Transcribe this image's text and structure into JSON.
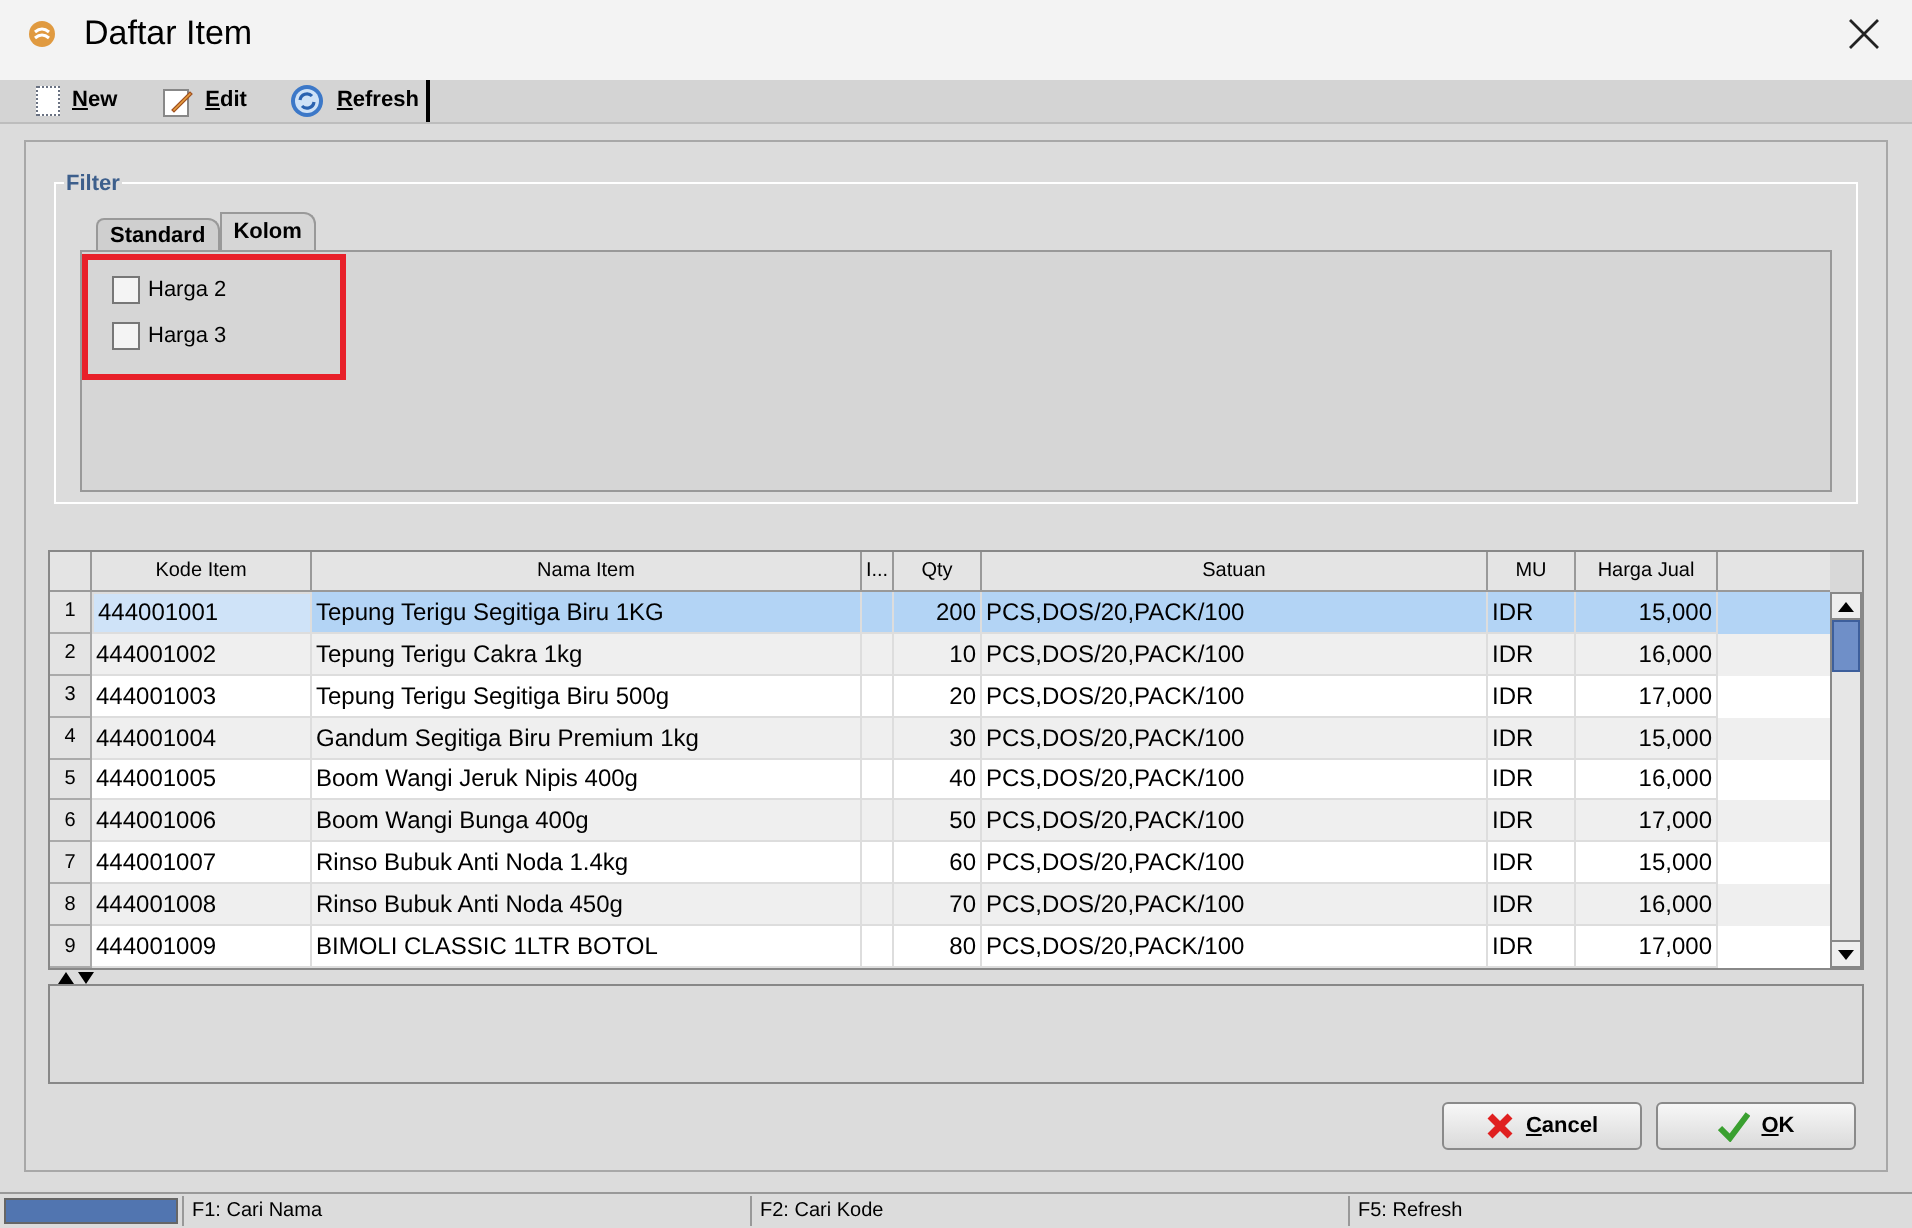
{
  "window": {
    "title": "Daftar Item"
  },
  "toolbar": [
    "New",
    "Edit",
    "Refresh"
  ],
  "filter": {
    "title": "Filter",
    "tabs": [
      {
        "label": "Standard",
        "selected": false
      },
      {
        "label": "Kolom",
        "selected": true
      }
    ],
    "options": [
      {
        "label": "Harga 2",
        "checked": false
      },
      {
        "label": "Harga 3",
        "checked": false
      }
    ]
  },
  "table": {
    "columns": [
      "Kode Item",
      "Nama Item",
      "I...",
      "Qty",
      "Satuan",
      "MU",
      "Harga Jual"
    ],
    "rows": [
      {
        "number": "1",
        "selected": true,
        "cells": [
          "444001001",
          "Tepung Terigu Segitiga Biru 1KG",
          "",
          "200",
          "PCS,DOS/20,PACK/100",
          "IDR",
          "15,000"
        ]
      },
      {
        "number": "2",
        "selected": false,
        "cells": [
          "444001002",
          "Tepung Terigu Cakra 1kg",
          "",
          "10",
          "PCS,DOS/20,PACK/100",
          "IDR",
          "16,000"
        ]
      },
      {
        "number": "3",
        "selected": false,
        "cells": [
          "444001003",
          "Tepung Terigu Segitiga Biru 500g",
          "",
          "20",
          "PCS,DOS/20,PACK/100",
          "IDR",
          "17,000"
        ]
      },
      {
        "number": "4",
        "selected": false,
        "cells": [
          "444001004",
          "Gandum Segitiga Biru Premium 1kg",
          "",
          "30",
          "PCS,DOS/20,PACK/100",
          "IDR",
          "15,000"
        ]
      },
      {
        "number": "5",
        "selected": false,
        "cells": [
          "444001005",
          "Boom Wangi Jeruk Nipis 400g",
          "",
          "40",
          "PCS,DOS/20,PACK/100",
          "IDR",
          "16,000"
        ]
      },
      {
        "number": "6",
        "selected": false,
        "cells": [
          "444001006",
          "Boom Wangi Bunga 400g",
          "",
          "50",
          "PCS,DOS/20,PACK/100",
          "IDR",
          "17,000"
        ]
      },
      {
        "number": "7",
        "selected": false,
        "cells": [
          "444001007",
          "Rinso Bubuk Anti Noda 1.4kg",
          "",
          "60",
          "PCS,DOS/20,PACK/100",
          "IDR",
          "15,000"
        ]
      },
      {
        "number": "8",
        "selected": false,
        "cells": [
          "444001008",
          "Rinso Bubuk Anti Noda 450g",
          "",
          "70",
          "PCS,DOS/20,PACK/100",
          "IDR",
          "16,000"
        ]
      },
      {
        "number": "9",
        "selected": false,
        "cells": [
          "444001009",
          "BIMOLI CLASSIC 1LTR BOTOL",
          "",
          "80",
          "PCS,DOS/20,PACK/100",
          "IDR",
          "17,000"
        ]
      }
    ]
  },
  "buttons": [
    {
      "kind": "cancel",
      "label": "Cancel"
    },
    {
      "kind": "ok",
      "label": "OK"
    }
  ],
  "status_bar": [
    "F1: Cari Nama",
    "F2: Cari Kode",
    "F5: Refresh"
  ]
}
